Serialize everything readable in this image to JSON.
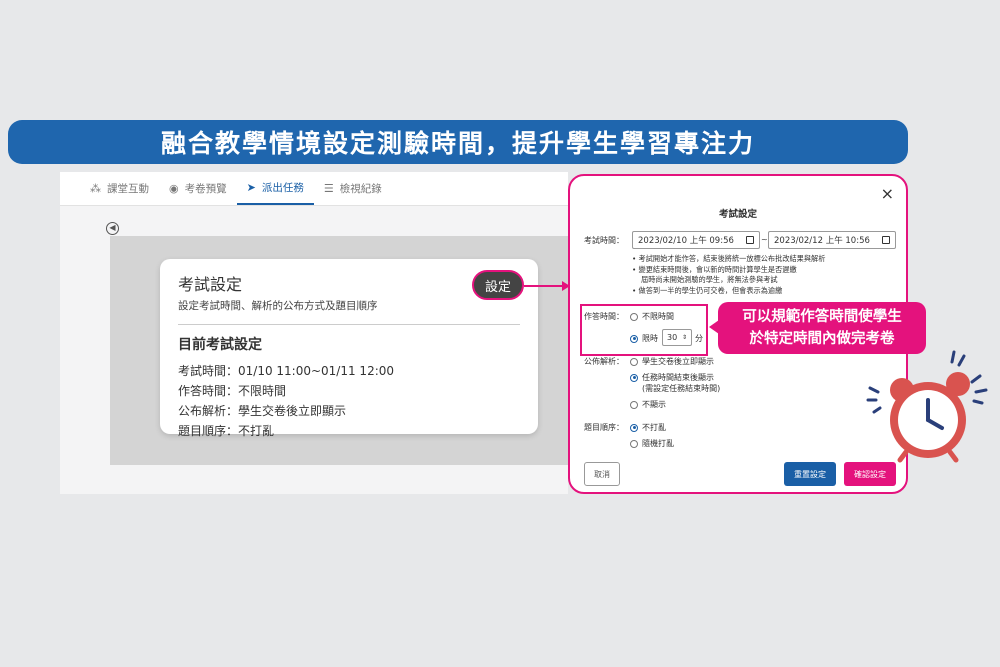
{
  "banner": {
    "title": "融合教學情境設定測驗時間，提升學生學習專注力"
  },
  "tabs": [
    {
      "label": "課堂互動",
      "icon": "grid-icon"
    },
    {
      "label": "考卷預覽",
      "icon": "eye-icon"
    },
    {
      "label": "派出任務",
      "icon": "send-icon"
    },
    {
      "label": "檢視紀錄",
      "icon": "list-icon"
    }
  ],
  "card": {
    "title": "考試設定",
    "subtitle": "設定考試時間、解析的公布方式及題目順序",
    "button": "設定",
    "current_heading": "目前考試設定",
    "lines": [
      "考試時間：01/10 11:00~01/11 12:00",
      "作答時間：不限時間",
      "公布解析：學生交卷後立即顯示",
      "題目順序：不打亂"
    ]
  },
  "modal": {
    "title": "考試設定",
    "close": "×",
    "exam_time_label": "考試時間：",
    "start": "2023/02/10 上午 09:56",
    "end": "2023/02/12 上午 10:56",
    "tilde": "~",
    "notes": [
      "• 考試開始才能作答，結束後將統一放標公布批改結果與解析",
      "• 變更結束時間後，會以新的時間計算學生是否遲繳",
      "   屆時尚未開始測驗的學生，將無法參與考試",
      "• 做答到一半的學生仍可交卷，但會表示為逾繳"
    ],
    "answer_time_label": "作答時間：",
    "answer_opt1": "不限時間",
    "answer_opt2": "限時",
    "minutes": "30",
    "minutes_unit": "分",
    "analysis_label": "公佈解析：",
    "analysis_opt1": "學生交卷後立即顯示",
    "analysis_opt2": "任務時間結束後顯示",
    "analysis_opt2_note": "(需設定任務結束時間)",
    "analysis_opt3": "不顯示",
    "order_label": "題目順序：",
    "order_opt1": "不打亂",
    "order_opt2": "隨機打亂",
    "cancel": "取消",
    "reset": "重置設定",
    "confirm": "確認設定"
  },
  "callout": {
    "line1": "可以規範作答時間使學生",
    "line2": "於特定時間內做完考卷"
  },
  "colors": {
    "brand_blue": "#1f66ae",
    "accent_pink": "#e4127d"
  }
}
